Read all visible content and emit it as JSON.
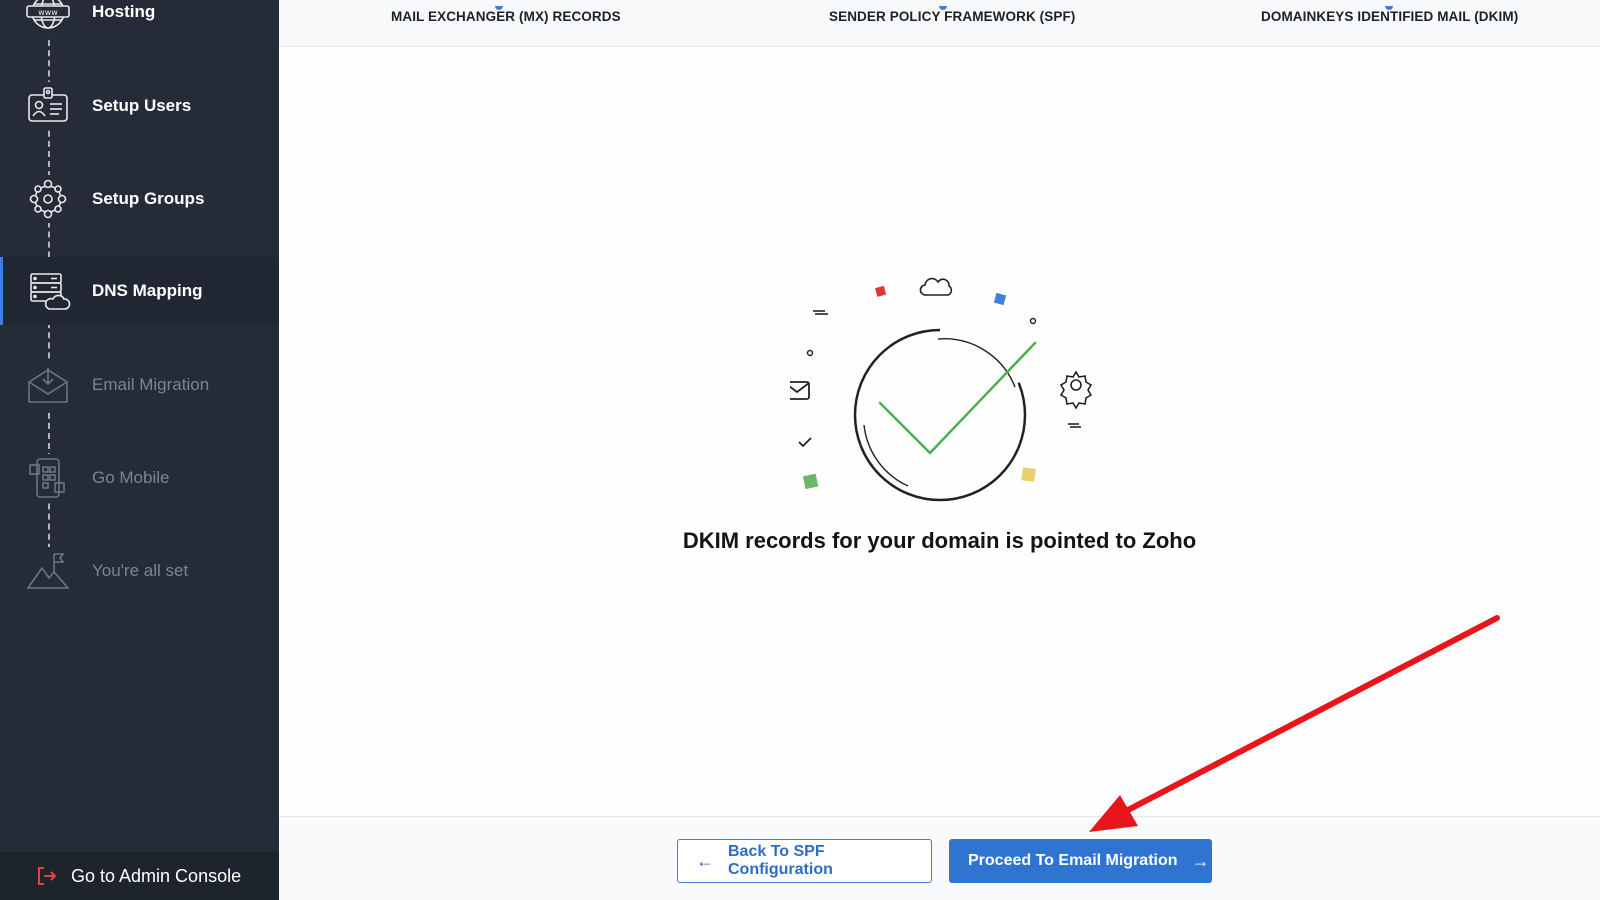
{
  "sidebar": {
    "items": [
      {
        "label": "Hosting",
        "icon": "globe-www-icon",
        "state": "done"
      },
      {
        "label": "Setup Users",
        "icon": "id-card-icon",
        "state": "done"
      },
      {
        "label": "Setup Groups",
        "icon": "group-network-icon",
        "state": "done"
      },
      {
        "label": "DNS Mapping",
        "icon": "server-cloud-icon",
        "state": "active"
      },
      {
        "label": "Email Migration",
        "icon": "envelope-download-icon",
        "state": "disabled"
      },
      {
        "label": "Go Mobile",
        "icon": "mobile-qr-icon",
        "state": "disabled"
      },
      {
        "label": "You're all set",
        "icon": "mountain-flag-icon",
        "state": "disabled"
      }
    ],
    "admin_console": {
      "label": "Go to Admin Console",
      "icon": "logout-icon"
    }
  },
  "steps": [
    {
      "label": "MAIL EXCHANGER (MX) RECORDS"
    },
    {
      "label": "SENDER POLICY FRAMEWORK (SPF)"
    },
    {
      "label": "DOMAINKEYS IDENTIFIED MAIL (DKIM)"
    }
  ],
  "main": {
    "message": "DKIM records for your domain is pointed to Zoho",
    "illustration_icon": "success-checkmark-illustration"
  },
  "footer": {
    "back_label": "Back To SPF Configuration",
    "next_label": "Proceed To Email Migration"
  },
  "colors": {
    "sidebar_bg": "#252c38",
    "accent": "#2f74d0",
    "check": "#4caf50",
    "annotation": "#e8161b"
  }
}
